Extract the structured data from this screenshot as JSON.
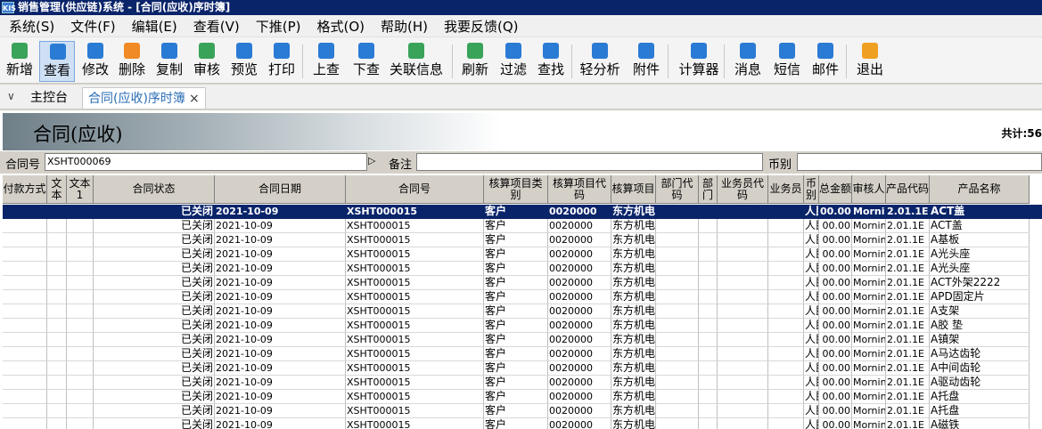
{
  "titlebar": {
    "logo": "KIS",
    "title": "销售管理(供应链)系统 - [合同(应收)序时簿]"
  },
  "menu": [
    "系统(S)",
    "文件(F)",
    "编辑(E)",
    "查看(V)",
    "下推(P)",
    "格式(O)",
    "帮助(H)",
    "我要反馈(Q)"
  ],
  "toolbar": [
    {
      "label": "新增",
      "icon": "add-icon",
      "color": "#3aa35a"
    },
    {
      "label": "查看",
      "icon": "view-icon",
      "color": "#2a7bd4",
      "active": true
    },
    {
      "label": "修改",
      "icon": "edit-icon",
      "color": "#2a7bd4"
    },
    {
      "label": "删除",
      "icon": "delete-icon",
      "color": "#f08a24"
    },
    {
      "label": "复制",
      "icon": "copy-icon",
      "color": "#2a7bd4"
    },
    {
      "label": "审核",
      "icon": "audit-icon",
      "color": "#3aa35a"
    },
    {
      "label": "预览",
      "icon": "preview-icon",
      "color": "#2a7bd4"
    },
    {
      "label": "打印",
      "icon": "print-icon",
      "color": "#2a7bd4"
    },
    {
      "label": "上查",
      "icon": "trace-up-icon",
      "color": "#2a7bd4"
    },
    {
      "label": "下查",
      "icon": "trace-down-icon",
      "color": "#2a7bd4"
    },
    {
      "label": "关联信息",
      "icon": "related-info-icon",
      "color": "#3aa35a"
    },
    {
      "label": "刷新",
      "icon": "refresh-icon",
      "color": "#3aa35a"
    },
    {
      "label": "过滤",
      "icon": "filter-icon",
      "color": "#2a7bd4"
    },
    {
      "label": "查找",
      "icon": "find-icon",
      "color": "#2a7bd4"
    },
    {
      "label": "轻分析",
      "icon": "analysis-icon",
      "color": "#2a7bd4"
    },
    {
      "label": "附件",
      "icon": "attachment-icon",
      "color": "#2a7bd4"
    },
    {
      "label": "计算器",
      "icon": "calculator-icon",
      "color": "#2a7bd4"
    },
    {
      "label": "消息",
      "icon": "message-icon",
      "color": "#2a7bd4"
    },
    {
      "label": "短信",
      "icon": "sms-icon",
      "color": "#2a7bd4"
    },
    {
      "label": "邮件",
      "icon": "mail-icon",
      "color": "#2a7bd4"
    },
    {
      "label": "退出",
      "icon": "exit-icon",
      "color": "#f0a020"
    }
  ],
  "tabs": {
    "home": "主控台",
    "current": "合同(应收)序时簿",
    "close": "×",
    "chevron": "∨"
  },
  "banner": {
    "title": "合同(应收)",
    "total": "共计:56"
  },
  "filters": {
    "contract_label": "合同号",
    "contract_value": "XSHT000069",
    "arrow": "▷",
    "note_label": "备注",
    "note_value": "",
    "currency_label": "币别",
    "currency_value": ""
  },
  "columns": [
    "付款方式",
    "文本",
    "文本1",
    "合同状态",
    "合同日期",
    "合同号",
    "核算项目类别",
    "核算项目代码",
    "核算项目",
    "部门代码",
    "部门",
    "业务员代码",
    "业务员",
    "币别",
    "总金额",
    "审核人",
    "产品代码",
    "产品名称"
  ],
  "rows": [
    [
      "",
      "",
      "",
      "已关闭",
      "2021-10-09",
      "XSHT000015",
      "客户",
      "0020000",
      "东方机电",
      "",
      "",
      "",
      "",
      "人民",
      "00.00",
      "Morni",
      "2.01.1E",
      "ACT盖"
    ],
    [
      "",
      "",
      "",
      "已关闭",
      "2021-10-09",
      "XSHT000015",
      "客户",
      "0020000",
      "东方机电",
      "",
      "",
      "",
      "",
      "人民",
      "00.00",
      "Mornin",
      "2.01.1E",
      "ACT盖"
    ],
    [
      "",
      "",
      "",
      "已关闭",
      "2021-10-09",
      "XSHT000015",
      "客户",
      "0020000",
      "东方机电",
      "",
      "",
      "",
      "",
      "人民",
      "00.00",
      "Mornin",
      "2.01.1E",
      "A基板"
    ],
    [
      "",
      "",
      "",
      "已关闭",
      "2021-10-09",
      "XSHT000015",
      "客户",
      "0020000",
      "东方机电",
      "",
      "",
      "",
      "",
      "人民",
      "00.00",
      "Mornin",
      "2.01.1E",
      "A光头座"
    ],
    [
      "",
      "",
      "",
      "已关闭",
      "2021-10-09",
      "XSHT000015",
      "客户",
      "0020000",
      "东方机电",
      "",
      "",
      "",
      "",
      "人民",
      "00.00",
      "Mornin",
      "2.01.1E",
      "A光头座"
    ],
    [
      "",
      "",
      "",
      "已关闭",
      "2021-10-09",
      "XSHT000015",
      "客户",
      "0020000",
      "东方机电",
      "",
      "",
      "",
      "",
      "人民",
      "00.00",
      "Mornin",
      "2.01.1E",
      "ACT外架2222"
    ],
    [
      "",
      "",
      "",
      "已关闭",
      "2021-10-09",
      "XSHT000015",
      "客户",
      "0020000",
      "东方机电",
      "",
      "",
      "",
      "",
      "人民",
      "00.00",
      "Mornin",
      "2.01.1E",
      "APD固定片"
    ],
    [
      "",
      "",
      "",
      "已关闭",
      "2021-10-09",
      "XSHT000015",
      "客户",
      "0020000",
      "东方机电",
      "",
      "",
      "",
      "",
      "人民",
      "00.00",
      "Mornin",
      "2.01.1E",
      "A支架"
    ],
    [
      "",
      "",
      "",
      "已关闭",
      "2021-10-09",
      "XSHT000015",
      "客户",
      "0020000",
      "东方机电",
      "",
      "",
      "",
      "",
      "人民",
      "00.00",
      "Mornin",
      "2.01.1E",
      "A胶  垫"
    ],
    [
      "",
      "",
      "",
      "已关闭",
      "2021-10-09",
      "XSHT000015",
      "客户",
      "0020000",
      "东方机电",
      "",
      "",
      "",
      "",
      "人民",
      "00.00",
      "Mornin",
      "2.01.1E",
      "A镇架"
    ],
    [
      "",
      "",
      "",
      "已关闭",
      "2021-10-09",
      "XSHT000015",
      "客户",
      "0020000",
      "东方机电",
      "",
      "",
      "",
      "",
      "人民",
      "00.00",
      "Mornin",
      "2.01.1E",
      "A马达齿轮"
    ],
    [
      "",
      "",
      "",
      "已关闭",
      "2021-10-09",
      "XSHT000015",
      "客户",
      "0020000",
      "东方机电",
      "",
      "",
      "",
      "",
      "人民",
      "00.00",
      "Mornin",
      "2.01.1E",
      "A中间齿轮"
    ],
    [
      "",
      "",
      "",
      "已关闭",
      "2021-10-09",
      "XSHT000015",
      "客户",
      "0020000",
      "东方机电",
      "",
      "",
      "",
      "",
      "人民",
      "00.00",
      "Mornin",
      "2.01.1E",
      "A驱动齿轮"
    ],
    [
      "",
      "",
      "",
      "已关闭",
      "2021-10-09",
      "XSHT000015",
      "客户",
      "0020000",
      "东方机电",
      "",
      "",
      "",
      "",
      "人民",
      "00.00",
      "Mornin",
      "2.01.1E",
      "A托盘"
    ],
    [
      "",
      "",
      "",
      "已关闭",
      "2021-10-09",
      "XSHT000015",
      "客户",
      "0020000",
      "东方机电",
      "",
      "",
      "",
      "",
      "人民",
      "00.00",
      "Mornin",
      "2.01.1E",
      "A托盘"
    ],
    [
      "",
      "",
      "",
      "已关闭",
      "2021-10-09",
      "XSHT000015",
      "客户",
      "0020000",
      "东方机电",
      "",
      "",
      "",
      "",
      "人民",
      "00.00",
      "Mornin",
      "2.01.1E",
      "A磁铁"
    ]
  ]
}
